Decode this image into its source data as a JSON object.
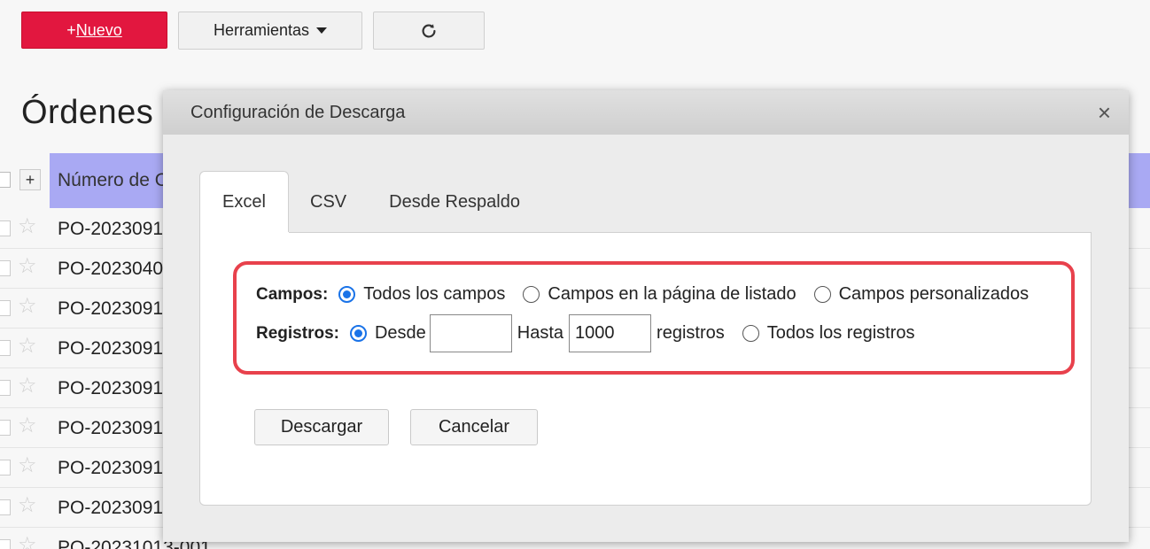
{
  "toolbar": {
    "new_label_prefix": "+",
    "new_label_main": "Nuevo",
    "tools_label": "Herramientas",
    "refresh_icon": "refresh-icon"
  },
  "page": {
    "title": "Órdenes"
  },
  "list": {
    "header_first_column": "Número de O",
    "rows": [
      "PO-2023091",
      "PO-2023040",
      "PO-2023091",
      "PO-2023091",
      "PO-2023091",
      "PO-2023091",
      "PO-2023091",
      "PO-2023091",
      "PO-20231013-001"
    ]
  },
  "modal": {
    "title": "Configuración de Descarga",
    "tabs": [
      {
        "label": "Excel",
        "active": true
      },
      {
        "label": "CSV",
        "active": false
      },
      {
        "label": "Desde Respaldo",
        "active": false
      }
    ],
    "fields_label": "Campos:",
    "fields_options": [
      {
        "label": "Todos los campos",
        "selected": true
      },
      {
        "label": "Campos en la página de listado",
        "selected": false
      },
      {
        "label": "Campos personalizados",
        "selected": false
      }
    ],
    "records_label": "Registros:",
    "records_from_label": "Desde",
    "records_from_value": "",
    "records_to_label": "Hasta",
    "records_to_value": "1000",
    "records_unit": "registros",
    "records_all_label": "Todos los registros",
    "download_label": "Descargar",
    "cancel_label": "Cancelar",
    "highlight_color": "#e8414c",
    "accent_color": "#1a73e8"
  }
}
